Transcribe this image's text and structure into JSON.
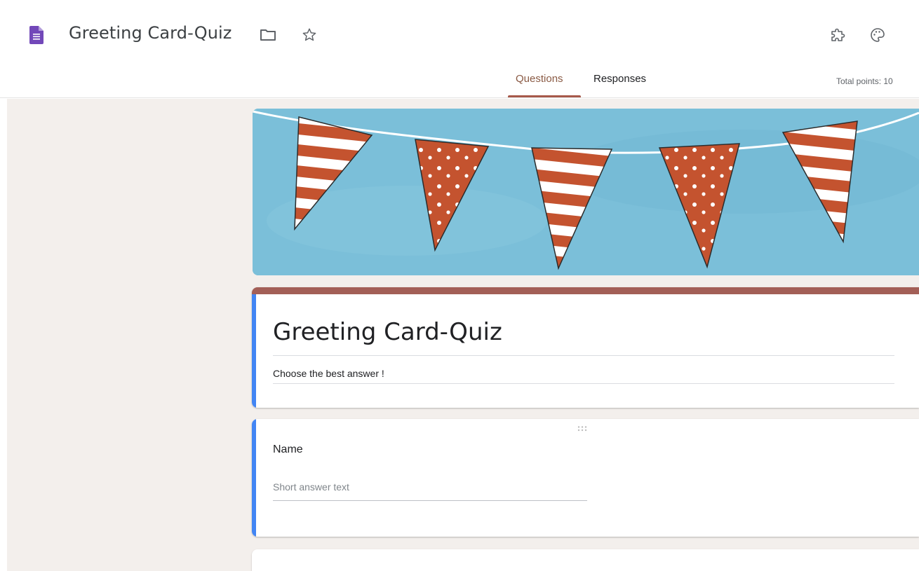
{
  "header": {
    "title": "Greeting Card-Quiz",
    "icons": [
      "forms-app-icon",
      "folder-icon",
      "star-icon",
      "addon-puzzle-icon",
      "palette-icon"
    ]
  },
  "tabs": [
    {
      "label": "Questions",
      "active": true
    },
    {
      "label": "Responses",
      "active": false
    }
  ],
  "total_points": "Total points: 10",
  "form": {
    "title": "Greeting Card-Quiz",
    "description": "Choose the best answer !"
  },
  "questions": [
    {
      "title": "Name",
      "answer_placeholder": "Short answer text"
    }
  ],
  "colors": {
    "accent": "#a35f57",
    "tab_active": "#8a5a44",
    "focus_bar": "#4285f4",
    "background": "#f3efec",
    "banner_sky": "#7bbfd9",
    "flag_red": "#c4532f"
  }
}
